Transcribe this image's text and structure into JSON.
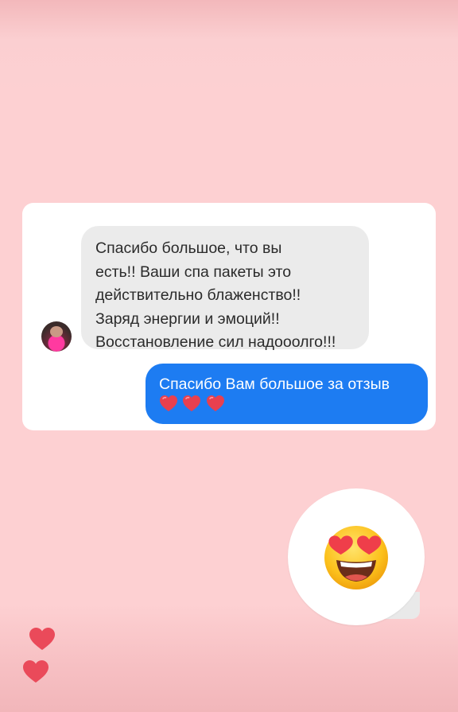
{
  "conversation": {
    "incoming": {
      "lines": [
        "Спасибо большое, что вы",
        "есть!! Ваши спа пакеты это",
        "действительно блаженство!!",
        "Заряд энергии и эмоций!!",
        "Восстановление сил надооолго!!!"
      ]
    },
    "outgoing": {
      "text": "Спасибо Вам большое за отзыв",
      "emoji": [
        "red-heart",
        "red-heart",
        "red-heart"
      ]
    }
  },
  "sticker": {
    "emoji": "heart-eyes-emoji"
  },
  "floating_hearts": [
    "red-heart",
    "red-heart"
  ],
  "colors": {
    "background": "#fdd0d2",
    "outgoing_bubble": "#1d7cf2",
    "incoming_bubble": "#ebebeb",
    "heart": "#ea4a5a"
  }
}
